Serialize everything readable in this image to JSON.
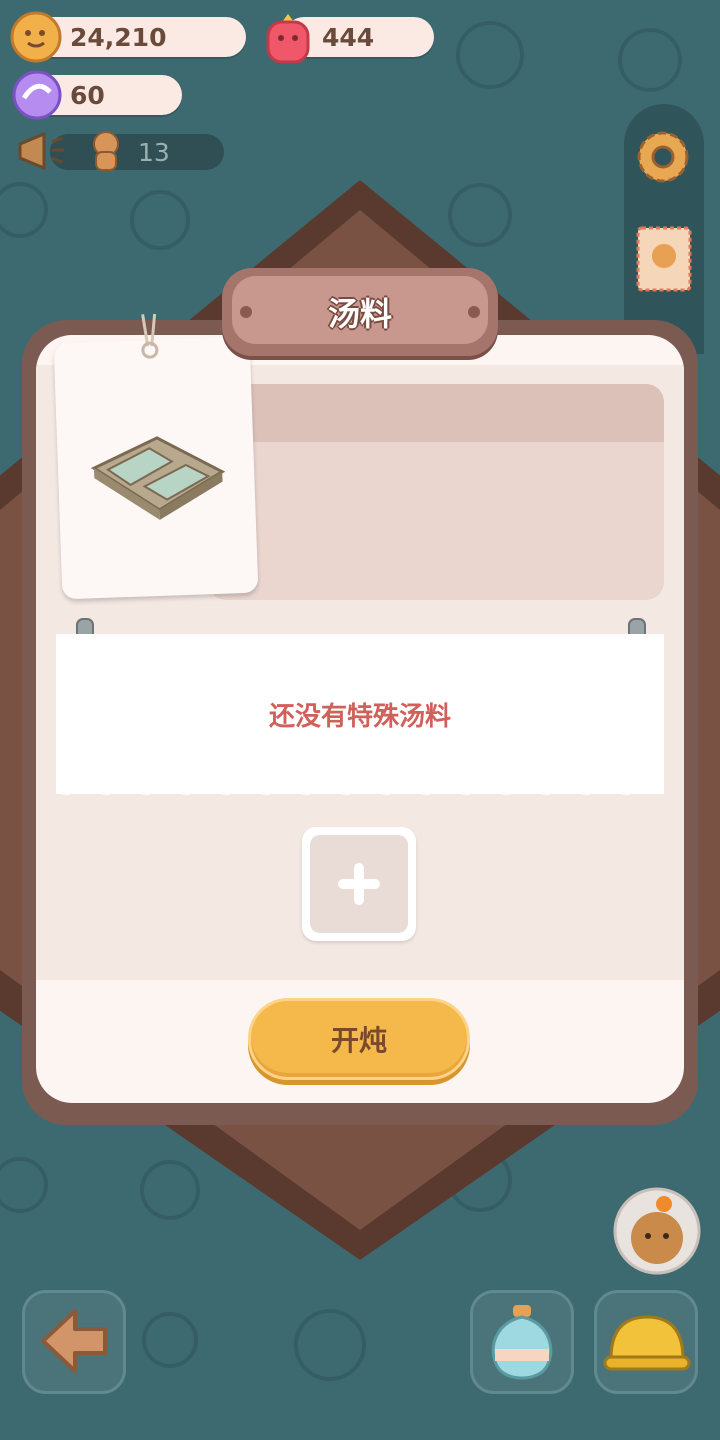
{
  "currencies": {
    "cookies": "24,210",
    "gems": "444",
    "candy": "60",
    "gingerbread": "13"
  },
  "panel": {
    "title": "汤料",
    "empty_message": "还没有特殊汤料",
    "start_button": "开炖"
  },
  "icons": {
    "cookie": "cookie-icon",
    "gem": "strawberry-gem-icon",
    "candy": "candy-icon",
    "megaphone": "megaphone-icon",
    "gingerbread": "gingerbread-icon",
    "settings": "gear-icon",
    "stamp": "stamp-icon",
    "back": "back-arrow-icon",
    "potion": "potion-icon",
    "hardhat": "hardhat-icon",
    "helper": "helper-avatar-icon",
    "plus": "plus-icon"
  },
  "colors": {
    "background": "#3d6a70",
    "accent_button": "#f4b94a",
    "message": "#d0605a"
  }
}
